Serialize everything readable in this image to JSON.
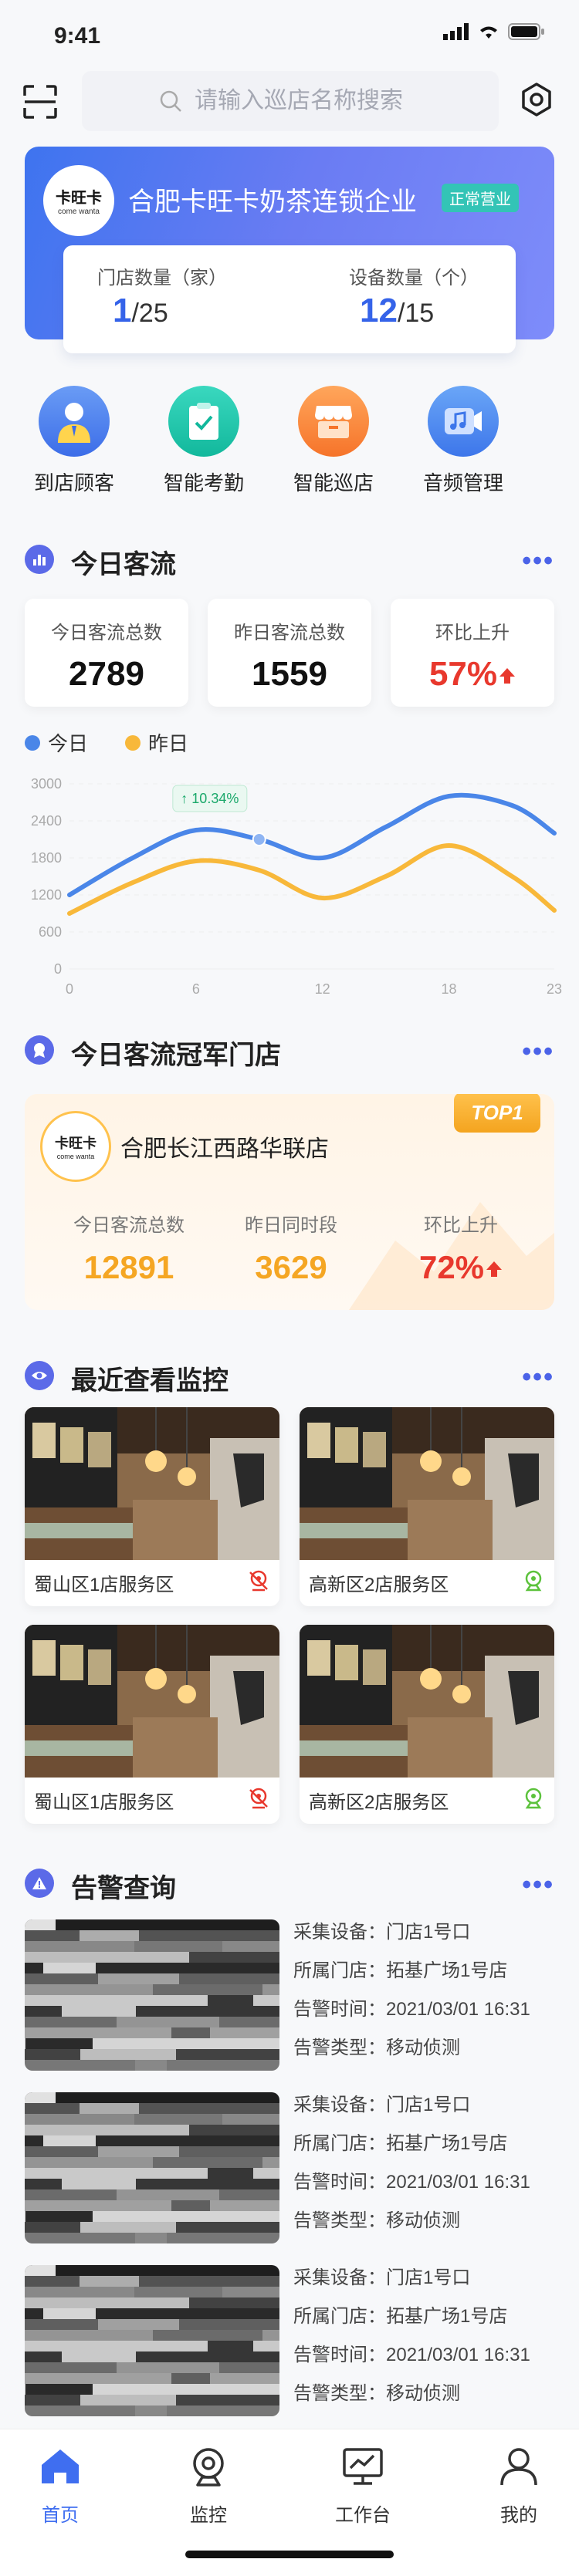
{
  "status_bar": {
    "time": "9:41"
  },
  "search": {
    "placeholder": "请输入巡店名称搜索"
  },
  "company": {
    "logo_text": "卡旺卡",
    "logo_sub": "come wanta",
    "name": "合肥卡旺卡奶茶连锁企业",
    "status": "正常营业",
    "store_label": "门店数量（家）",
    "store_value": "1",
    "store_total": "/25",
    "device_label": "设备数量（个）",
    "device_value": "12",
    "device_total": "/15"
  },
  "quick_actions": [
    {
      "label": "到店顾客",
      "color": "#4a7df0"
    },
    {
      "label": "智能考勤",
      "color": "#1fc3a8"
    },
    {
      "label": "智能巡店",
      "color": "#fb8a3e"
    },
    {
      "label": "音频管理",
      "color": "#4a8af0"
    }
  ],
  "traffic": {
    "title": "今日客流",
    "more": "•••",
    "kpis": [
      {
        "label": "今日客流总数",
        "value": "2789"
      },
      {
        "label": "昨日客流总数",
        "value": "1559"
      },
      {
        "label": "环比上升",
        "value": "57%"
      }
    ],
    "legend_today": "今日",
    "legend_yesterday": "昨日",
    "tooltip": "10.34%"
  },
  "chart_data": {
    "type": "line",
    "x": [
      0,
      3,
      6,
      9,
      12,
      15,
      18,
      21,
      23
    ],
    "xticks": [
      "0",
      "6",
      "12",
      "18",
      "23"
    ],
    "yticks": [
      "0",
      "600",
      "1200",
      "1800",
      "2400",
      "3000"
    ],
    "ylim": [
      0,
      3000
    ],
    "series": [
      {
        "name": "今日",
        "color": "#4a86e8",
        "values": [
          1200,
          1800,
          2250,
          2100,
          1800,
          2300,
          2800,
          2650,
          2200
        ]
      },
      {
        "name": "昨日",
        "color": "#f8b83a",
        "values": [
          900,
          1400,
          1750,
          1600,
          1150,
          1500,
          2000,
          1500,
          950
        ]
      }
    ]
  },
  "champion": {
    "title": "今日客流冠军门店",
    "more": "•••",
    "badge": "TOP1",
    "store_name": "合肥长江西路华联店",
    "stats": [
      {
        "label": "今日客流总数",
        "value": "12891"
      },
      {
        "label": "昨日同时段",
        "value": "3629"
      },
      {
        "label": "环比上升",
        "value": "72%"
      }
    ]
  },
  "monitors": {
    "title": "最近查看监控",
    "more": "•••",
    "items": [
      {
        "label": "蜀山区1店服务区",
        "status": "offline"
      },
      {
        "label": "高新区2店服务区",
        "status": "online"
      },
      {
        "label": "蜀山区1店服务区",
        "status": "offline"
      },
      {
        "label": "高新区2店服务区",
        "status": "online"
      }
    ]
  },
  "alerts": {
    "title": "告警查询",
    "more": "•••",
    "items": [
      {
        "device": "采集设备：门店1号口",
        "store": "所属门店：拓基广场1号店",
        "time": "告警时间：2021/03/01 16:31",
        "type": "告警类型：移动侦测"
      },
      {
        "device": "采集设备：门店1号口",
        "store": "所属门店：拓基广场1号店",
        "time": "告警时间：2021/03/01 16:31",
        "type": "告警类型：移动侦测"
      },
      {
        "device": "采集设备：门店1号口",
        "store": "所属门店：拓基广场1号店",
        "time": "告警时间：2021/03/01 16:31",
        "type": "告警类型：移动侦测"
      }
    ]
  },
  "tabbar": [
    {
      "label": "首页",
      "active": true
    },
    {
      "label": "监控",
      "active": false
    },
    {
      "label": "工作台",
      "active": false
    },
    {
      "label": "我的",
      "active": false
    }
  ]
}
